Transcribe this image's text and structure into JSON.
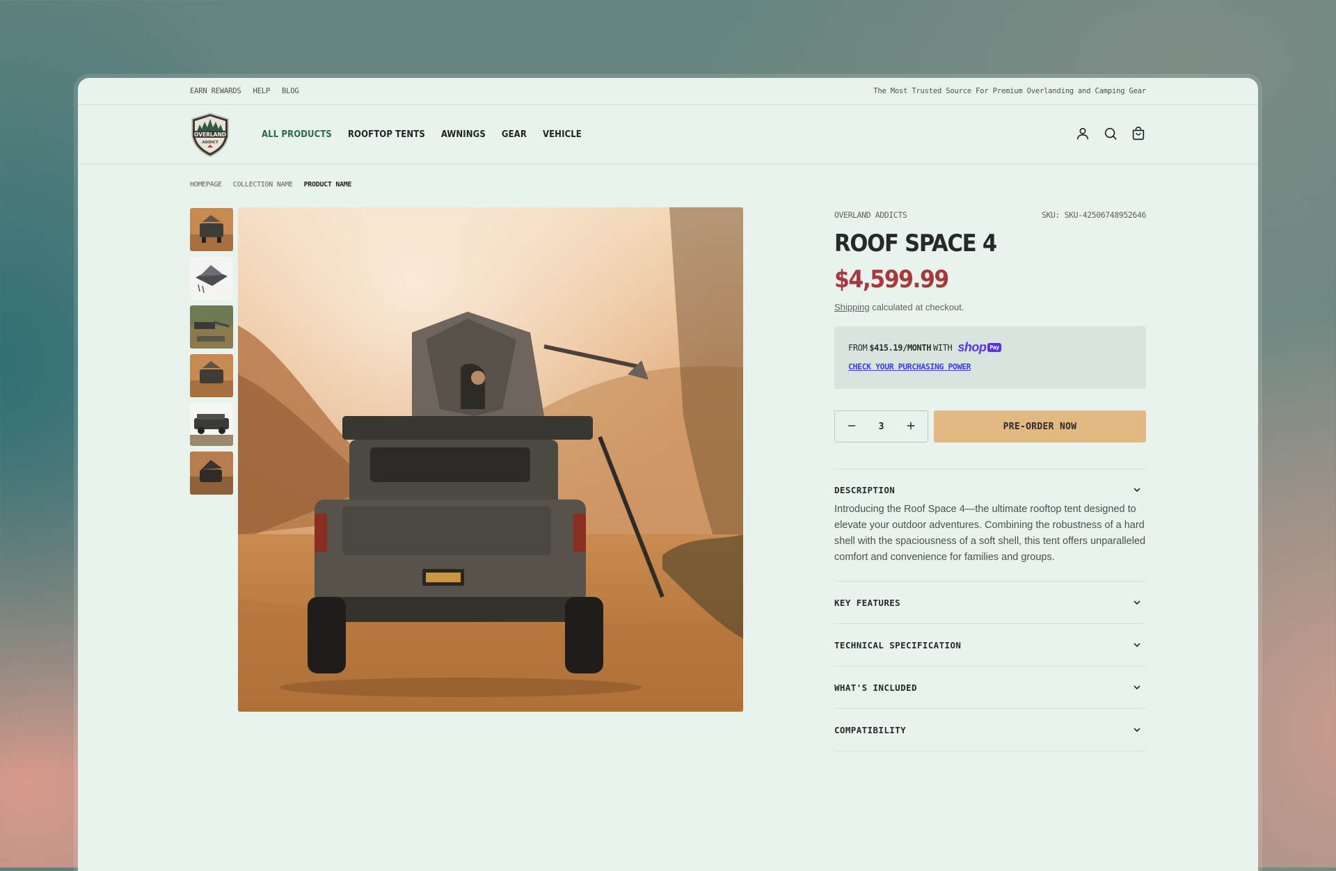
{
  "topbar": {
    "links": [
      "EARN REWARDS",
      "HELP",
      "BLOG"
    ],
    "tagline": "The Most Trusted Source For Premium Overlanding and Camping Gear"
  },
  "logo": {
    "line1": "OVERLAND",
    "line2": "ADDICT"
  },
  "nav": {
    "items": [
      "ALL PRODUCTS",
      "ROOFTOP TENTS",
      "AWNINGS",
      "GEAR",
      "VEHICLE"
    ],
    "active": "ALL PRODUCTS"
  },
  "header_icons": [
    "account-icon",
    "search-icon",
    "cart-icon"
  ],
  "breadcrumb": [
    "HOMEPAGE",
    "COLLECTION NAME",
    "PRODUCT NAME"
  ],
  "gallery": {
    "thumbnail_count": 6
  },
  "product": {
    "brand": "OVERLAND ADDICTS",
    "sku": "SKU: SKU-42506748952646",
    "title": "ROOF SPACE 4",
    "price": "$4,599.99",
    "shipping_link": "Shipping",
    "shipping_text": " calculated at checkout.",
    "installment_prefix": "FROM",
    "installment_amount": "$415.19/MONTH",
    "installment_suffix": "WITH",
    "shoppay_word": "shop",
    "shoppay_badge": "Pay",
    "purchasing_power_link": "CHECK YOUR PURCHASING POWER",
    "quantity": "3",
    "cta": "PRE-ORDER NOW",
    "accent_color": "#a8383b",
    "cta_color": "#e2b982"
  },
  "accordion": [
    {
      "title": "DESCRIPTION",
      "body": "Introducing the Roof Space 4—the ultimate rooftop tent designed to elevate your outdoor adventures. Combining the robustness of a hard shell with the spaciousness of a soft shell, this tent offers unparalleled comfort and convenience for families and groups."
    },
    {
      "title": "KEY FEATURES"
    },
    {
      "title": "TECHNICAL SPECIFICATION"
    },
    {
      "title": "WHAT'S INCLUDED"
    },
    {
      "title": "COMPATIBILITY"
    }
  ]
}
